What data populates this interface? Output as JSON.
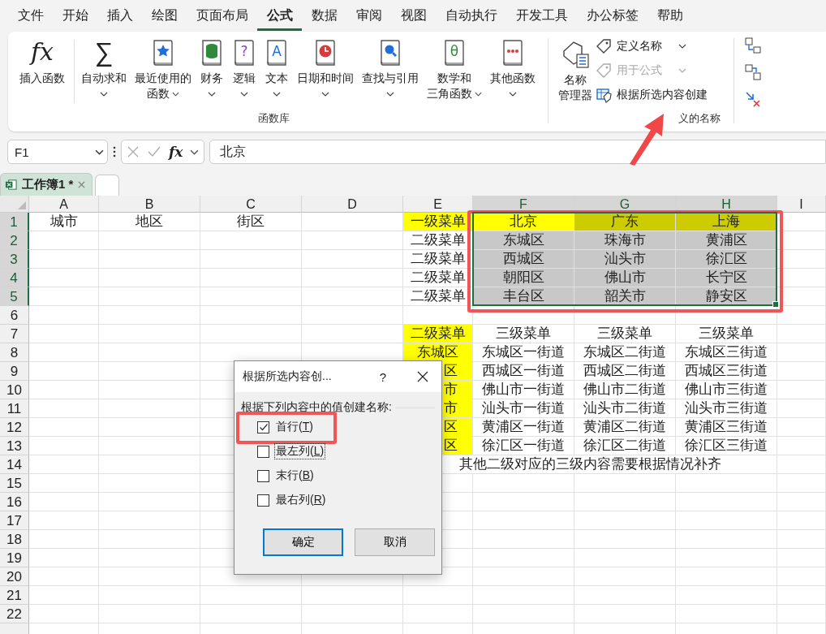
{
  "menu_tabs": [
    {
      "label": "文件",
      "selected": false
    },
    {
      "label": "开始",
      "selected": false
    },
    {
      "label": "插入",
      "selected": false
    },
    {
      "label": "绘图",
      "selected": false
    },
    {
      "label": "页面布局",
      "selected": false
    },
    {
      "label": "公式",
      "selected": true
    },
    {
      "label": "数据",
      "selected": false
    },
    {
      "label": "审阅",
      "selected": false
    },
    {
      "label": "视图",
      "selected": false
    },
    {
      "label": "自动执行",
      "selected": false
    },
    {
      "label": "开发工具",
      "selected": false
    },
    {
      "label": "办公标签",
      "selected": false
    },
    {
      "label": "帮助",
      "selected": false
    }
  ],
  "ribbon": {
    "function_library": {
      "label": "函数库",
      "buttons": [
        {
          "lines": [
            "插入函数"
          ],
          "menu": false,
          "kind": "plain",
          "glyph": "fx"
        },
        {
          "lines": [
            "自动求和"
          ],
          "menu": true,
          "kind": "plain",
          "glyph": "∑"
        },
        {
          "lines": [
            "最近使用的",
            "函数"
          ],
          "menu": true,
          "kind": "book",
          "color": "#1e6fd9"
        },
        {
          "lines": [
            "财务"
          ],
          "menu": true,
          "kind": "book",
          "color": "#2e8b3a"
        },
        {
          "lines": [
            "逻辑"
          ],
          "menu": true,
          "kind": "book",
          "color": "#9b3fc1",
          "glyph": "?"
        },
        {
          "lines": [
            "文本"
          ],
          "menu": true,
          "kind": "book",
          "color": "#1e6fd9",
          "glyph": "A"
        },
        {
          "lines": [
            "日期和时间"
          ],
          "menu": true,
          "kind": "book",
          "color": "#d83b3b"
        },
        {
          "lines": [
            "查找与引用"
          ],
          "menu": true,
          "kind": "book",
          "color": "#1e6fd9"
        },
        {
          "lines": [
            "数学和",
            "三角函数"
          ],
          "menu": true,
          "kind": "book",
          "color": "#2e8b3a",
          "glyph": "θ"
        },
        {
          "lines": [
            "其他函数"
          ],
          "menu": true,
          "kind": "book",
          "color": "#d83b3b"
        }
      ]
    },
    "defined_names": {
      "label": "义的名称",
      "manager": {
        "lines": [
          "名称",
          "管理器"
        ]
      },
      "items": [
        {
          "label": "定义名称",
          "menu": true,
          "disabled": false
        },
        {
          "label": "用于公式",
          "menu": true,
          "disabled": true
        },
        {
          "label": "根据所选内容创建",
          "menu": false,
          "disabled": false
        }
      ]
    }
  },
  "formula_bar": {
    "name_box": "F1",
    "fx": "fx",
    "formula": "北京"
  },
  "sheet_tabs": [
    {
      "label": "工作簿1 *",
      "selected": true
    }
  ],
  "columns": [
    {
      "label": "A",
      "selected": false
    },
    {
      "label": "B",
      "selected": false
    },
    {
      "label": "C",
      "selected": false
    },
    {
      "label": "D",
      "selected": false
    },
    {
      "label": "E",
      "selected": false
    },
    {
      "label": "F",
      "selected": true
    },
    {
      "label": "G",
      "selected": true
    },
    {
      "label": "H",
      "selected": true
    },
    {
      "label": "I",
      "selected": false
    }
  ],
  "rows": [
    {
      "label": "1",
      "selected": true,
      "cells": [
        {
          "text": "城市"
        },
        {
          "text": "地区"
        },
        {
          "text": "街区"
        },
        {},
        {
          "text": "一级菜单",
          "color": "#ffff00"
        },
        {
          "text": "北京",
          "color": "#ffff00"
        },
        {
          "text": "广东",
          "color": "#cccc00"
        },
        {
          "text": "上海",
          "color": "#cccc00"
        }
      ]
    },
    {
      "label": "2",
      "selected": true,
      "cells": [
        {},
        {},
        {},
        {},
        {
          "text": "二级菜单"
        },
        {
          "text": "东城区",
          "color": "#c8c8c8"
        },
        {
          "text": "珠海市",
          "color": "#c8c8c8"
        },
        {
          "text": "黄浦区",
          "color": "#c8c8c8"
        }
      ]
    },
    {
      "label": "3",
      "selected": true,
      "cells": [
        {},
        {},
        {},
        {},
        {
          "text": "二级菜单"
        },
        {
          "text": "西城区",
          "color": "#c8c8c8"
        },
        {
          "text": "汕头市",
          "color": "#c8c8c8"
        },
        {
          "text": "徐汇区",
          "color": "#c8c8c8"
        }
      ]
    },
    {
      "label": "4",
      "selected": true,
      "cells": [
        {},
        {},
        {},
        {},
        {
          "text": "二级菜单"
        },
        {
          "text": "朝阳区",
          "color": "#c8c8c8"
        },
        {
          "text": "佛山市",
          "color": "#c8c8c8"
        },
        {
          "text": "长宁区",
          "color": "#c8c8c8"
        }
      ]
    },
    {
      "label": "5",
      "selected": true,
      "cells": [
        {},
        {},
        {},
        {},
        {
          "text": "二级菜单"
        },
        {
          "text": "丰台区",
          "color": "#c8c8c8"
        },
        {
          "text": "韶关市",
          "color": "#c8c8c8"
        },
        {
          "text": "静安区",
          "color": "#c8c8c8"
        }
      ]
    },
    {
      "label": "6",
      "selected": false
    },
    {
      "label": "7",
      "selected": false,
      "cells": [
        {},
        {},
        {},
        {},
        {
          "text": "二级菜单",
          "color": "#ffff00"
        },
        {
          "text": "三级菜单"
        },
        {
          "text": "三级菜单"
        },
        {
          "text": "三级菜单"
        }
      ]
    },
    {
      "label": "8",
      "selected": false,
      "cells": [
        {},
        {},
        {},
        {},
        {
          "text": "东城区",
          "color": "#ffff00"
        },
        {
          "text": "东城区一街道"
        },
        {
          "text": "东城区二街道"
        },
        {
          "text": "东城区三街道"
        }
      ]
    },
    {
      "label": "9",
      "selected": false,
      "cells": [
        {},
        {},
        {},
        {},
        {
          "text": "区",
          "color": "#ffff00",
          "clipped": true
        },
        {
          "text": "西城区一街道"
        },
        {
          "text": "西城区二街道"
        },
        {
          "text": "西城区三街道"
        }
      ]
    },
    {
      "label": "10",
      "selected": false,
      "cells": [
        {},
        {},
        {},
        {},
        {
          "text": "市",
          "color": "#ffff00",
          "clipped": true
        },
        {
          "text": "佛山市一街道"
        },
        {
          "text": "佛山市二街道"
        },
        {
          "text": "佛山市三街道"
        }
      ]
    },
    {
      "label": "11",
      "selected": false,
      "cells": [
        {},
        {},
        {},
        {},
        {
          "text": "市",
          "color": "#ffff00",
          "clipped": true
        },
        {
          "text": "汕头市一街道"
        },
        {
          "text": "汕头市二街道"
        },
        {
          "text": "汕头市三街道"
        }
      ]
    },
    {
      "label": "12",
      "selected": false,
      "cells": [
        {},
        {},
        {},
        {},
        {
          "text": "区",
          "color": "#ffff00",
          "clipped": true
        },
        {
          "text": "黄浦区一街道"
        },
        {
          "text": "黄浦区二街道"
        },
        {
          "text": "黄浦区三街道"
        }
      ]
    },
    {
      "label": "13",
      "selected": false,
      "cells": [
        {},
        {},
        {},
        {},
        {
          "text": "区",
          "color": "#ffff00",
          "clipped": true
        },
        {
          "text": "徐汇区一街道"
        },
        {
          "text": "徐汇区二街道"
        },
        {
          "text": "徐汇区三街道"
        }
      ]
    },
    {
      "label": "14",
      "selected": false,
      "cells": [
        {},
        {},
        {},
        {},
        {
          "text": "其他二级对应的三级内容需要根据情况补齐",
          "merged": true
        }
      ]
    },
    {
      "label": "15",
      "selected": false
    },
    {
      "label": "16",
      "selected": false
    },
    {
      "label": "17",
      "selected": false
    },
    {
      "label": "18",
      "selected": false
    },
    {
      "label": "19",
      "selected": false
    },
    {
      "label": "20",
      "selected": false
    },
    {
      "label": "21",
      "selected": false
    },
    {
      "label": "22",
      "selected": false
    }
  ],
  "dialog": {
    "title": "根据所选内容创...",
    "help": "?",
    "group_label": "根据下列内容中的值创建名称:",
    "options": [
      {
        "label_before": "首行(",
        "access_key": "T",
        "label_after": ")",
        "checked": true,
        "focused": false
      },
      {
        "label_before": "最左列(",
        "access_key": "L",
        "label_after": ")",
        "checked": false,
        "focused": true
      },
      {
        "label_before": "末行(",
        "access_key": "B",
        "label_after": ")",
        "checked": false,
        "focused": false
      },
      {
        "label_before": "最右列(",
        "access_key": "R",
        "label_after": ")",
        "checked": false,
        "focused": false
      }
    ],
    "buttons": [
      {
        "label": "确定",
        "default": true
      },
      {
        "label": "取消",
        "default": false
      }
    ]
  },
  "annotations": [
    {
      "kind": "frame-selection"
    },
    {
      "kind": "frame-first-option"
    },
    {
      "kind": "arrow"
    }
  ]
}
